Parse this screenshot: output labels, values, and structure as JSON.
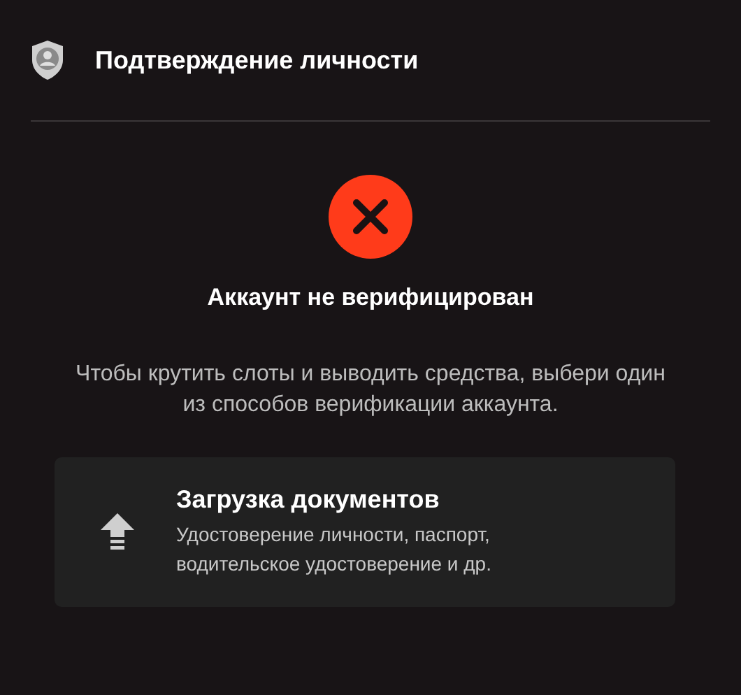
{
  "header": {
    "title": "Подтверждение личности"
  },
  "status": {
    "title": "Аккаунт не верифицирован",
    "description": "Чтобы крутить слоты и выводить средства, выбери один из способов верификации аккаунта."
  },
  "methods": [
    {
      "title": "Загрузка документов",
      "description": "Удостоверение личности, паспорт, водительское удостоверение и др."
    }
  ]
}
